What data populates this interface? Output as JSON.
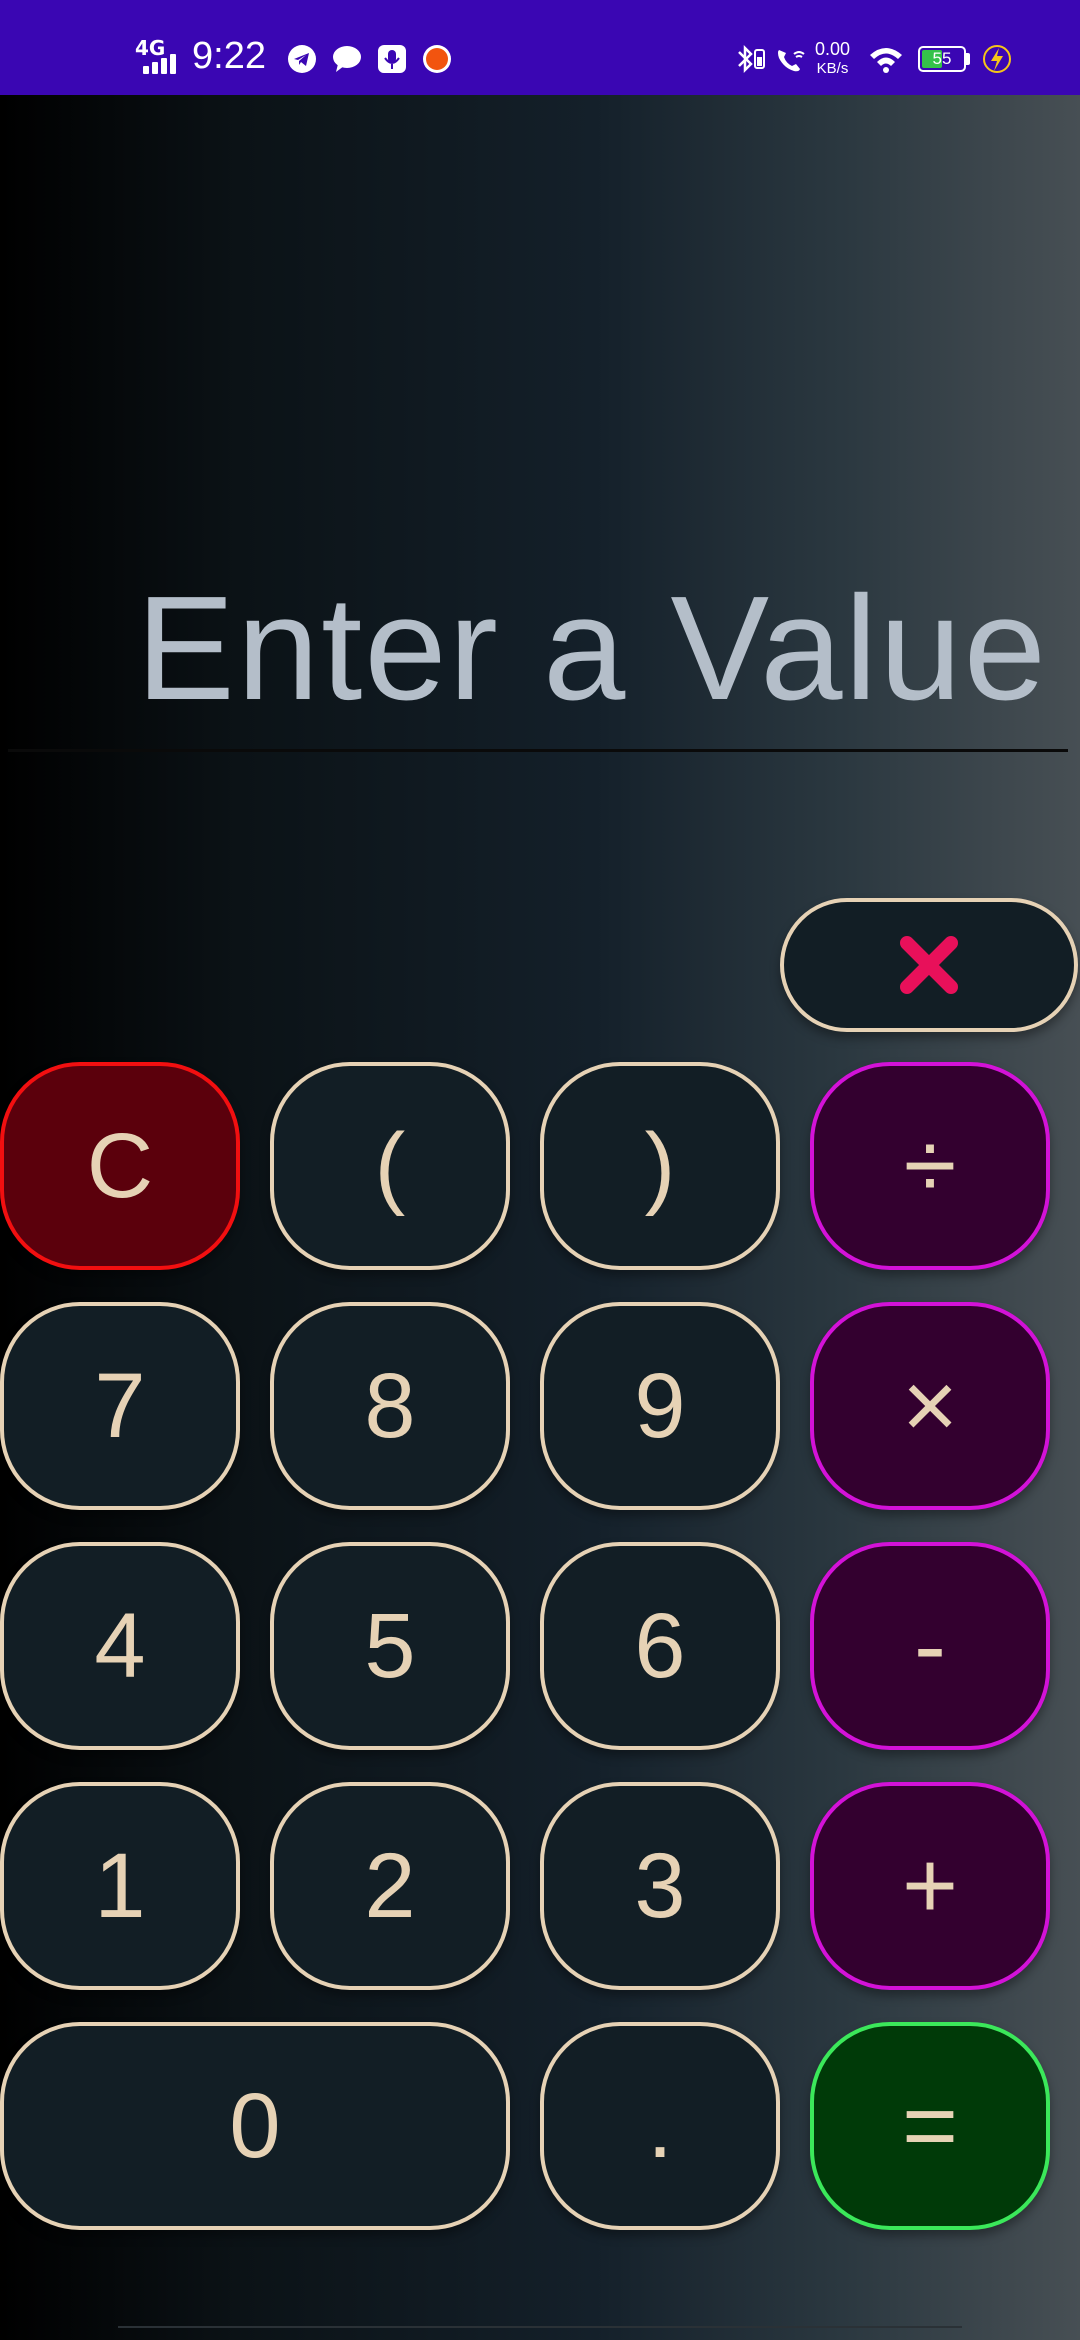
{
  "status_bar": {
    "network": "4G",
    "time": "9:22",
    "icons": [
      "telegram-icon",
      "chat-bubble-icon",
      "voice-recorder-icon",
      "record-dot-icon",
      "bluetooth-icon",
      "vibrate-icon",
      "wifi-call-icon",
      "wifi-icon",
      "charging-bolt-icon"
    ],
    "speed_value": "0.00",
    "speed_unit": "KB/s",
    "battery_level": "55",
    "battery_fraction": 0.55
  },
  "display": {
    "placeholder": "Enter a Value",
    "text_color": "#b4bec9"
  },
  "keys": {
    "backspace": "✕",
    "clear": "C",
    "paren_open": "(",
    "paren_close": ")",
    "divide": "÷",
    "seven": "7",
    "eight": "8",
    "nine": "9",
    "multiply": "×",
    "four": "4",
    "five": "5",
    "six": "6",
    "minus": "-",
    "one": "1",
    "two": "2",
    "three": "3",
    "plus": "+",
    "zero": "0",
    "dot": ".",
    "equals": "="
  },
  "colors": {
    "status_bar": "#3a06b3",
    "key_border": "#e6d2b5",
    "key_fill": "#121e25",
    "clear_border": "#f20f10",
    "clear_fill": "#5b000c",
    "operator_border": "#d312d8",
    "operator_fill": "#33002f",
    "equals_border": "#3be85a",
    "equals_fill": "#003a08",
    "backspace_icon": "#e8105a"
  }
}
